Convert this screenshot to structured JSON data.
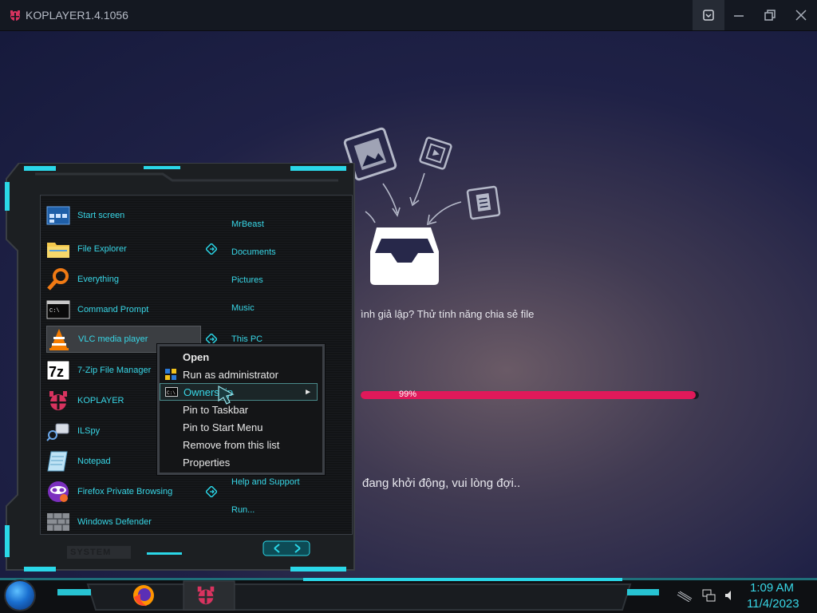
{
  "window": {
    "title": "KOPLAYER1.4.1056"
  },
  "content": {
    "share_text": "ình giả lập? Thử tính năng chia sẻ file",
    "progress_value": 0.99,
    "progress_label": "99%",
    "boot_text": "đang khởi động, vui lòng đợi.."
  },
  "start_menu": {
    "apps": [
      {
        "label": "Start screen",
        "icon": "start-screen-icon"
      },
      {
        "label": "File Explorer",
        "icon": "folder-icon"
      },
      {
        "label": "Everything",
        "icon": "magnifier-icon"
      },
      {
        "label": "Command Prompt",
        "icon": "terminal-icon"
      },
      {
        "label": "VLC media player",
        "icon": "vlc-cone-icon"
      },
      {
        "label": "7-Zip File Manager",
        "icon": "7zip-icon"
      },
      {
        "label": "KOPLAYER",
        "icon": "koplayer-icon"
      },
      {
        "label": "ILSpy",
        "icon": "ilspy-icon"
      },
      {
        "label": "Notepad",
        "icon": "notepad-icon"
      },
      {
        "label": "Firefox Private Browsing",
        "icon": "firefox-private-icon"
      },
      {
        "label": "Windows Defender",
        "icon": "defender-wall-icon"
      }
    ],
    "places": [
      {
        "label": "MrBeast"
      },
      {
        "label": "Documents"
      },
      {
        "label": "Pictures"
      },
      {
        "label": "Music"
      },
      {
        "label": "This PC"
      },
      {
        "label": "Help and Support"
      },
      {
        "label": "Run..."
      }
    ],
    "system_label": "SYSTEM"
  },
  "context_menu": {
    "items": [
      {
        "label": "Open",
        "bold": true
      },
      {
        "label": "Run as administrator",
        "icon": "shield-icon"
      },
      {
        "label": "Ownership",
        "icon": "terminal-icon",
        "submenu": true,
        "hover": true
      },
      {
        "label": "Pin to Taskbar"
      },
      {
        "label": "Pin to Start Menu"
      },
      {
        "label": "Remove from this list"
      },
      {
        "label": "Properties"
      }
    ]
  },
  "taskbar": {
    "time": "1:09 AM",
    "date": "11/4/2023"
  },
  "colors": {
    "accent_cyan": "#38d6e6",
    "progress_pink": "#e0195a"
  }
}
